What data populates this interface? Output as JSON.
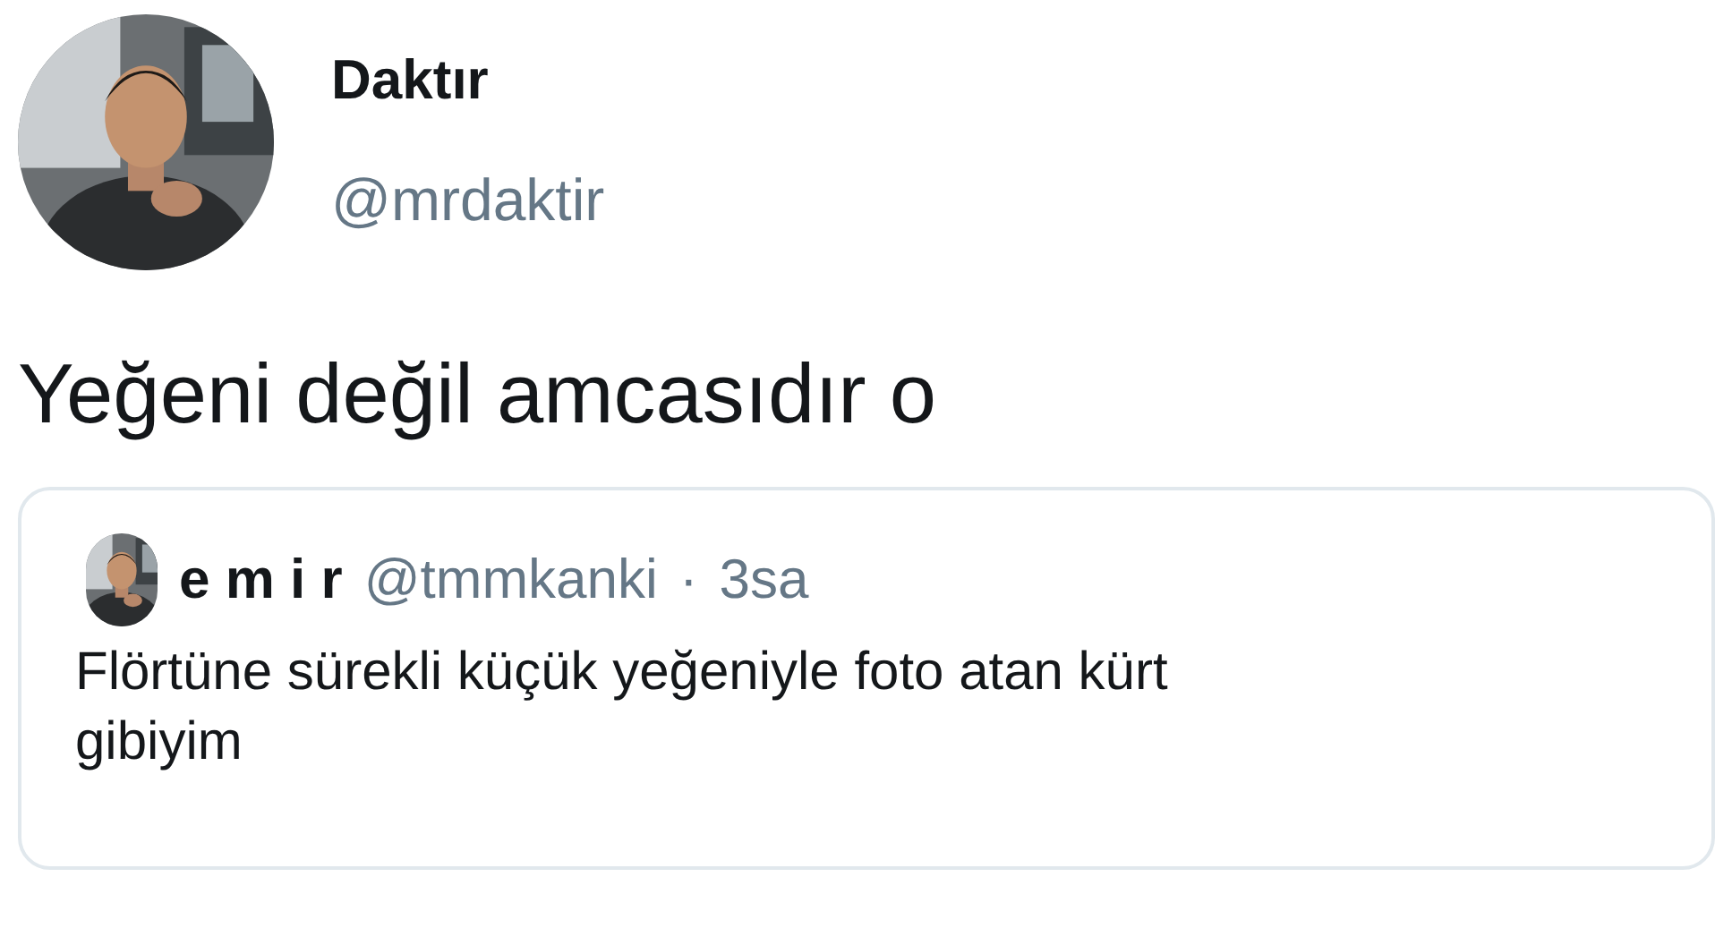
{
  "author": {
    "name": "Daktır",
    "handle": "@mrdaktir"
  },
  "tweet_text": "Yeğeni değil amcasıdır o",
  "quoted_tweet": {
    "name": "e m i r",
    "handle": "@tmmkanki",
    "separator": "·",
    "time": "3sa",
    "text": "Flörtüne sürekli küçük yeğeniyle foto atan kürt gibiyim"
  }
}
